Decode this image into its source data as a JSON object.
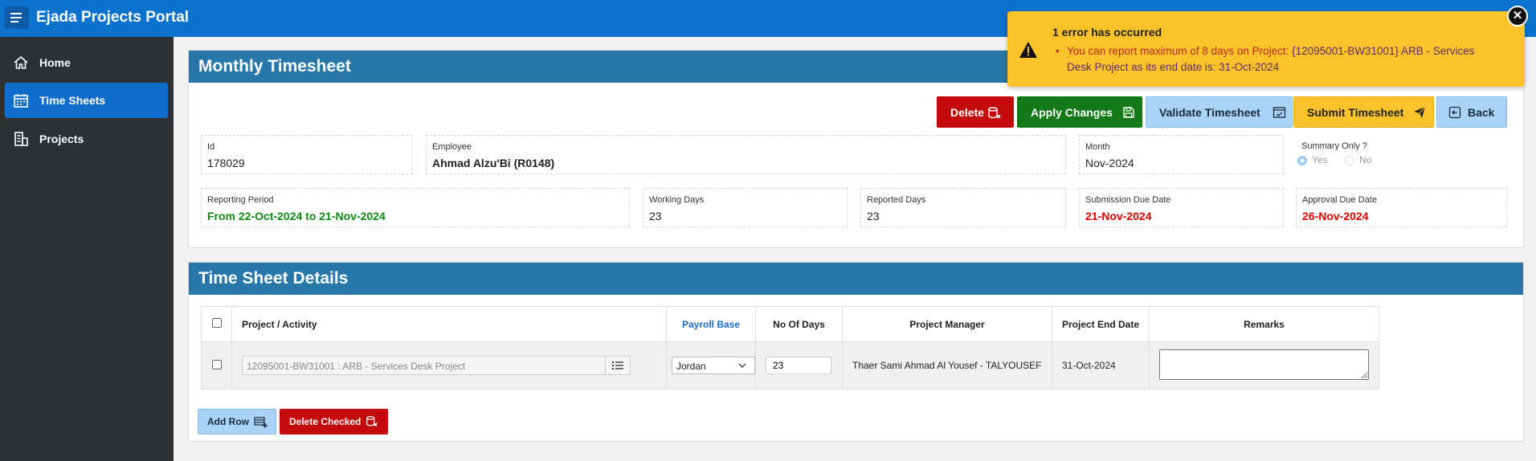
{
  "app": {
    "title": "Ejada Projects Portal"
  },
  "sidebar": {
    "items": [
      {
        "label": "Home",
        "icon": "home-icon"
      },
      {
        "label": "Time Sheets",
        "icon": "calendar-icon",
        "active": true
      },
      {
        "label": "Projects",
        "icon": "buildings-icon"
      }
    ]
  },
  "timesheet": {
    "title": "Monthly Timesheet",
    "buttons": {
      "delete": "Delete",
      "apply": "Apply Changes",
      "validate": "Validate Timesheet",
      "submit": "Submit Timesheet",
      "back": "Back"
    },
    "fields": {
      "id_label": "Id",
      "id_value": "178029",
      "employee_label": "Employee",
      "employee_value": "Ahmad Alzu'Bi (R0148)",
      "month_label": "Month",
      "month_value": "Nov-2024",
      "summary_label": "Summary Only ?",
      "summary_yes": "Yes",
      "summary_no": "No",
      "summary_selected": "Yes",
      "period_label": "Reporting Period",
      "period_value": "From 22-Oct-2024 to 21-Nov-2024",
      "working_label": "Working Days",
      "working_value": "23",
      "reported_label": "Reported Days",
      "reported_value": "23",
      "submission_label": "Submission Due Date",
      "submission_value": "21-Nov-2024",
      "approval_label": "Approval Due Date",
      "approval_value": "26-Nov-2024"
    }
  },
  "details": {
    "title": "Time Sheet Details",
    "columns": [
      "Project / Activity",
      "Payroll Base",
      "No Of Days",
      "Project Manager",
      "Project End Date",
      "Remarks"
    ],
    "rows": [
      {
        "project": "12095001-BW31001 :   ARB - Services Desk Project",
        "payroll": "Jordan",
        "days": "23",
        "manager": "Thaer Sami Ahmad Al Yousef - TALYOUSEF",
        "end_date": "31-Oct-2024",
        "remarks": ""
      }
    ],
    "add_row": "Add Row",
    "delete_checked": "Delete Checked"
  },
  "alert": {
    "title": "1 error has occurred",
    "message_red_1": "You can report maximum of 8 days on Project: ",
    "message_project": "{12095001-BW31001} ARB - Services Desk Project",
    "message_dark": " as its end date is: 31-Oct-2024",
    "colors": {
      "background": "#fbc329",
      "error_text": "#bb2a24"
    }
  },
  "colors": {
    "topbar": "#0b72cd",
    "sidebar": "#2d3134",
    "active_nav": "#0f6dcc",
    "card_header": "#2778a8"
  }
}
